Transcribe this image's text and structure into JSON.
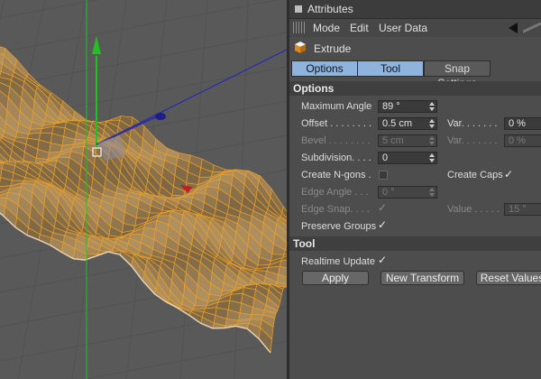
{
  "panel": {
    "title": "Attributes",
    "menu": [
      "Mode",
      "Edit",
      "User Data"
    ],
    "object_name": "Extrude",
    "tabs": [
      {
        "label": "Options",
        "active": true
      },
      {
        "label": "Tool",
        "active": true
      },
      {
        "label": "Snap Settings",
        "active": false
      }
    ],
    "sections": {
      "options": "Options",
      "tool": "Tool"
    },
    "fields": {
      "max_angle": {
        "label": "Maximum Angle",
        "value": "89 °"
      },
      "offset": {
        "label": "Offset . . . . . . . .",
        "value": "0.5 cm"
      },
      "offset_var": {
        "label": "Var. . . . . . .",
        "value": "0 %"
      },
      "bevel": {
        "label": "Bevel . . . . . . . .",
        "value": "5 cm"
      },
      "bevel_var": {
        "label": "Var. . . . . . .",
        "value": "0 %"
      },
      "subdivision": {
        "label": "Subdivision. . . .",
        "value": "0"
      },
      "create_ngons": {
        "label": "Create N-gons .",
        "checked": false
      },
      "create_caps": {
        "label": "Create Caps",
        "checked": true
      },
      "edge_angle": {
        "label": "Edge Angle . . .",
        "value": "0 °"
      },
      "edge_snap": {
        "label": "Edge Snap. . . .",
        "checked": true
      },
      "value": {
        "label": "Value . . . . .",
        "value": "15 °"
      },
      "preserve_groups": {
        "label": "Preserve Groups",
        "checked": true
      },
      "realtime_update": {
        "label": "Realtime Update",
        "checked": true
      }
    },
    "buttons": {
      "apply": "Apply",
      "new_transform": "New Transform",
      "reset_values": "Reset Values"
    },
    "check_glyph": "✓"
  },
  "colors": {
    "tab_active": "#8fb3dc",
    "mesh_wire": "#f0a020",
    "axis_green": "#22c022",
    "axis_blue": "#2020c0",
    "axis_red": "#c02020"
  }
}
